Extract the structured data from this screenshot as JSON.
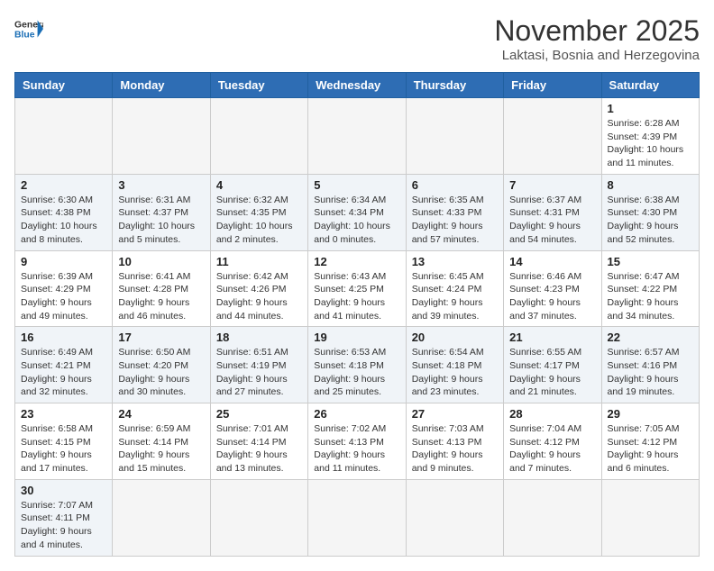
{
  "logo": {
    "general": "General",
    "blue": "Blue"
  },
  "title": "November 2025",
  "subtitle": "Laktasi, Bosnia and Herzegovina",
  "weekdays": [
    "Sunday",
    "Monday",
    "Tuesday",
    "Wednesday",
    "Thursday",
    "Friday",
    "Saturday"
  ],
  "weeks": [
    [
      {
        "day": "",
        "info": ""
      },
      {
        "day": "",
        "info": ""
      },
      {
        "day": "",
        "info": ""
      },
      {
        "day": "",
        "info": ""
      },
      {
        "day": "",
        "info": ""
      },
      {
        "day": "",
        "info": ""
      },
      {
        "day": "1",
        "info": "Sunrise: 6:28 AM\nSunset: 4:39 PM\nDaylight: 10 hours and 11 minutes."
      }
    ],
    [
      {
        "day": "2",
        "info": "Sunrise: 6:30 AM\nSunset: 4:38 PM\nDaylight: 10 hours and 8 minutes."
      },
      {
        "day": "3",
        "info": "Sunrise: 6:31 AM\nSunset: 4:37 PM\nDaylight: 10 hours and 5 minutes."
      },
      {
        "day": "4",
        "info": "Sunrise: 6:32 AM\nSunset: 4:35 PM\nDaylight: 10 hours and 2 minutes."
      },
      {
        "day": "5",
        "info": "Sunrise: 6:34 AM\nSunset: 4:34 PM\nDaylight: 10 hours and 0 minutes."
      },
      {
        "day": "6",
        "info": "Sunrise: 6:35 AM\nSunset: 4:33 PM\nDaylight: 9 hours and 57 minutes."
      },
      {
        "day": "7",
        "info": "Sunrise: 6:37 AM\nSunset: 4:31 PM\nDaylight: 9 hours and 54 minutes."
      },
      {
        "day": "8",
        "info": "Sunrise: 6:38 AM\nSunset: 4:30 PM\nDaylight: 9 hours and 52 minutes."
      }
    ],
    [
      {
        "day": "9",
        "info": "Sunrise: 6:39 AM\nSunset: 4:29 PM\nDaylight: 9 hours and 49 minutes."
      },
      {
        "day": "10",
        "info": "Sunrise: 6:41 AM\nSunset: 4:28 PM\nDaylight: 9 hours and 46 minutes."
      },
      {
        "day": "11",
        "info": "Sunrise: 6:42 AM\nSunset: 4:26 PM\nDaylight: 9 hours and 44 minutes."
      },
      {
        "day": "12",
        "info": "Sunrise: 6:43 AM\nSunset: 4:25 PM\nDaylight: 9 hours and 41 minutes."
      },
      {
        "day": "13",
        "info": "Sunrise: 6:45 AM\nSunset: 4:24 PM\nDaylight: 9 hours and 39 minutes."
      },
      {
        "day": "14",
        "info": "Sunrise: 6:46 AM\nSunset: 4:23 PM\nDaylight: 9 hours and 37 minutes."
      },
      {
        "day": "15",
        "info": "Sunrise: 6:47 AM\nSunset: 4:22 PM\nDaylight: 9 hours and 34 minutes."
      }
    ],
    [
      {
        "day": "16",
        "info": "Sunrise: 6:49 AM\nSunset: 4:21 PM\nDaylight: 9 hours and 32 minutes."
      },
      {
        "day": "17",
        "info": "Sunrise: 6:50 AM\nSunset: 4:20 PM\nDaylight: 9 hours and 30 minutes."
      },
      {
        "day": "18",
        "info": "Sunrise: 6:51 AM\nSunset: 4:19 PM\nDaylight: 9 hours and 27 minutes."
      },
      {
        "day": "19",
        "info": "Sunrise: 6:53 AM\nSunset: 4:18 PM\nDaylight: 9 hours and 25 minutes."
      },
      {
        "day": "20",
        "info": "Sunrise: 6:54 AM\nSunset: 4:18 PM\nDaylight: 9 hours and 23 minutes."
      },
      {
        "day": "21",
        "info": "Sunrise: 6:55 AM\nSunset: 4:17 PM\nDaylight: 9 hours and 21 minutes."
      },
      {
        "day": "22",
        "info": "Sunrise: 6:57 AM\nSunset: 4:16 PM\nDaylight: 9 hours and 19 minutes."
      }
    ],
    [
      {
        "day": "23",
        "info": "Sunrise: 6:58 AM\nSunset: 4:15 PM\nDaylight: 9 hours and 17 minutes."
      },
      {
        "day": "24",
        "info": "Sunrise: 6:59 AM\nSunset: 4:14 PM\nDaylight: 9 hours and 15 minutes."
      },
      {
        "day": "25",
        "info": "Sunrise: 7:01 AM\nSunset: 4:14 PM\nDaylight: 9 hours and 13 minutes."
      },
      {
        "day": "26",
        "info": "Sunrise: 7:02 AM\nSunset: 4:13 PM\nDaylight: 9 hours and 11 minutes."
      },
      {
        "day": "27",
        "info": "Sunrise: 7:03 AM\nSunset: 4:13 PM\nDaylight: 9 hours and 9 minutes."
      },
      {
        "day": "28",
        "info": "Sunrise: 7:04 AM\nSunset: 4:12 PM\nDaylight: 9 hours and 7 minutes."
      },
      {
        "day": "29",
        "info": "Sunrise: 7:05 AM\nSunset: 4:12 PM\nDaylight: 9 hours and 6 minutes."
      }
    ],
    [
      {
        "day": "30",
        "info": "Sunrise: 7:07 AM\nSunset: 4:11 PM\nDaylight: 9 hours and 4 minutes."
      },
      {
        "day": "",
        "info": ""
      },
      {
        "day": "",
        "info": ""
      },
      {
        "day": "",
        "info": ""
      },
      {
        "day": "",
        "info": ""
      },
      {
        "day": "",
        "info": ""
      },
      {
        "day": "",
        "info": ""
      }
    ]
  ]
}
